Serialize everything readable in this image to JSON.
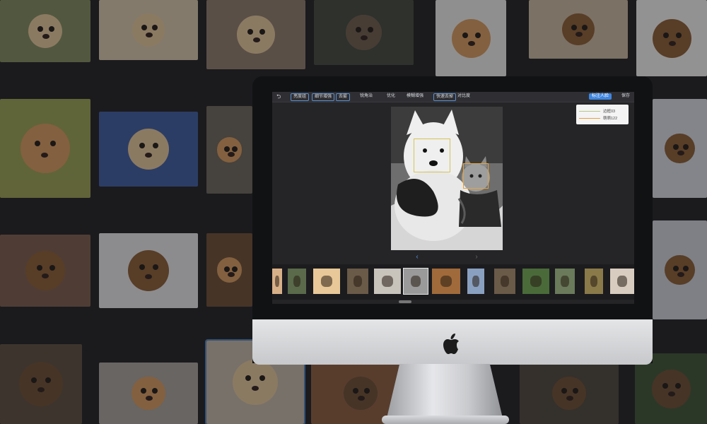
{
  "background_tiles": [
    {
      "id": "hamster-hand",
      "icon": "hamster"
    },
    {
      "id": "hamster-palm",
      "icon": "hamster"
    },
    {
      "id": "hamster-eating",
      "icon": "hamster"
    },
    {
      "id": "pika-grass",
      "icon": "pika"
    },
    {
      "id": "ginger-cat",
      "icon": "cat"
    },
    {
      "id": "dachshund-bag",
      "icon": "dog"
    },
    {
      "id": "french-bulldog",
      "icon": "dog"
    },
    {
      "id": "surprised-cat",
      "icon": "cat"
    },
    {
      "id": "two-hamsters",
      "icon": "hamster"
    },
    {
      "id": "cat-tongue",
      "icon": "cat"
    },
    {
      "id": "bull-terrier",
      "icon": "dog"
    },
    {
      "id": "beagle-glasses",
      "icon": "dog"
    },
    {
      "id": "sitting-dachshund",
      "icon": "dog"
    },
    {
      "id": "lying-cat",
      "icon": "cat"
    },
    {
      "id": "bernese-dog",
      "icon": "dog"
    },
    {
      "id": "brown-bear",
      "icon": "bear"
    },
    {
      "id": "kitten-room",
      "icon": "cat"
    },
    {
      "id": "fluffy-hamster",
      "icon": "hamster"
    },
    {
      "id": "ted-bear",
      "icon": "bear"
    },
    {
      "id": "bear-cub",
      "icon": "bear"
    },
    {
      "id": "white-bear-forest",
      "icon": "bear"
    }
  ],
  "app": {
    "toolbar": {
      "back_icon": "back-arrow-icon",
      "buttons": [
        {
          "label": "亮度组",
          "boxed": true
        },
        {
          "label": "细节增强",
          "boxed": true
        },
        {
          "label": "去雾",
          "boxed": true
        },
        {
          "label": "锐角治",
          "boxed": false
        },
        {
          "label": "优化",
          "boxed": false
        },
        {
          "label": "模糊增强",
          "boxed": false
        },
        {
          "label": "快速去掉",
          "boxed": true
        },
        {
          "label": "对比度",
          "boxed": false
        }
      ],
      "primary_button": "标注人脸",
      "save_label": "保存"
    },
    "info_popover": {
      "rows": [
        {
          "label": "边框03",
          "color": "#b6c98a"
        },
        {
          "label": "萌萌122",
          "color": "#e8a23a"
        }
      ]
    },
    "nav": {
      "prev": "‹",
      "next": "›"
    },
    "thumbnails": [
      {
        "id": "t0",
        "subject": "partial"
      },
      {
        "id": "t1",
        "subject": "bear-cub"
      },
      {
        "id": "t2",
        "subject": "hamster"
      },
      {
        "id": "t3",
        "subject": "bear"
      },
      {
        "id": "t4",
        "subject": "room"
      },
      {
        "id": "t5",
        "subject": "dog-and-cat",
        "selected": true
      },
      {
        "id": "t6",
        "subject": "ted-bear"
      },
      {
        "id": "t7",
        "subject": "landscape"
      },
      {
        "id": "t8",
        "subject": "bear"
      },
      {
        "id": "t9",
        "subject": "forest-bear"
      },
      {
        "id": "t10",
        "subject": "forest"
      },
      {
        "id": "t11",
        "subject": "monkey"
      },
      {
        "id": "t12",
        "subject": "bear-walk"
      }
    ]
  }
}
